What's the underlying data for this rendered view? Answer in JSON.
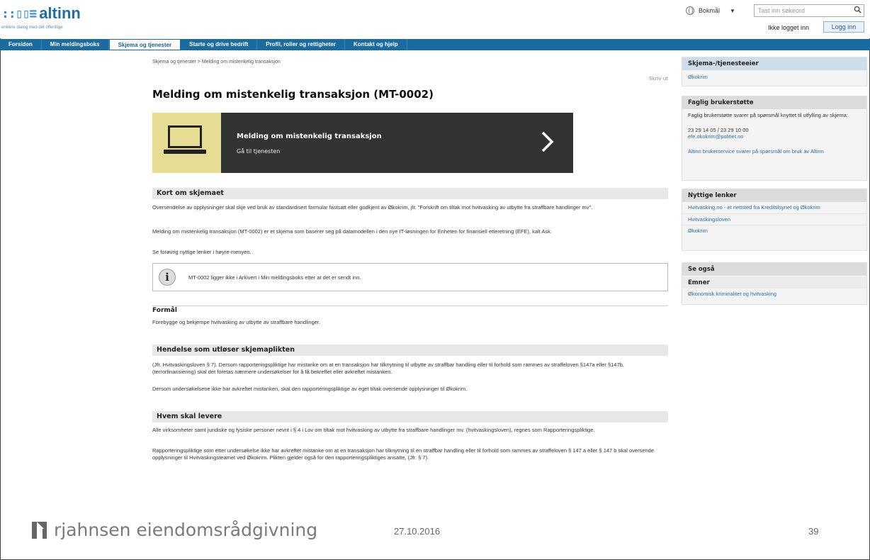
{
  "header": {
    "logo_mark": "::▯▯≡",
    "logo_text": "altinn",
    "tagline": "enklere dialog med det offentlige",
    "language": "Bokmål",
    "search_placeholder": "Tast inn søkeord",
    "login_status": "Ikke logget inn",
    "login_button": "Logg inn"
  },
  "nav": {
    "items": [
      {
        "label": "Forsiden"
      },
      {
        "label": "Min meldingsboks"
      },
      {
        "label": "Skjema og tjenester"
      },
      {
        "label": "Starte og drive bedrift"
      },
      {
        "label": "Profil, roller og rettigheter"
      },
      {
        "label": "Kontakt og hjelp"
      }
    ]
  },
  "main": {
    "breadcrumb": "Skjema og tjenester  >  Melding om mistenkelig transaksjon",
    "print": "Skriv ut",
    "title": "Melding om mistenkelig transaksjon (MT-0002)",
    "banner": {
      "title": "Melding om mistenkelig transaksjon",
      "subtitle": "Gå til tjenesten"
    },
    "section1": {
      "heading": "Kort om skjemaet",
      "p1": "Oversendelse av opplysninger skal skje ved bruk av standardisert formular fastsatt eller godkjent av Økokrim, jfr. \"Forskrift om tiltak mot hvitvasking av utbytte fra straffbare handlinger mv\".",
      "p2": "Melding om mistenkelig transaksjon (MT-0002) er et skjema som baserer seg på datamodellen i den nye IT-løsningen for Enheten for finansiell etteretning (EFE), kalt Ask.",
      "p3": "Se forøvrig nyttige lenker i høyre-menyen."
    },
    "info": "MT-0002 ligger ikke i Arkivert i Min meldingsboks etter at det er sendt inn.",
    "formal": {
      "heading": "Formål",
      "text": "Forebygge og bekjempe hvitvasking av utbytte av straffbare handlinger."
    },
    "section2": {
      "heading": "Hendelse som utløser skjemaplikten",
      "p1": "(Jfr. Hvitvaskingsloven § 7). Dersom rapporteringspliktige har mistanke om at en transaksjon har tilknytning til utbytte av straffbar handling eller til forhold som rammes av straffeloven §147a eller §147b, (terrorfinansiering) skal det foretas nærmere undersøkelser for å få bekreftet eller avkreftet mistanken.",
      "p2": "Dersom undersøkelsene ikke har avkreftet mistanken, skal den rapporteringspliktige av eget tiltak oversende opplysninger til Økokrim."
    },
    "section3": {
      "heading": "Hvem skal levere",
      "p1": "Alle virksomheter samt juridiske og fysiske personer nevnt i § 4 i Lov om tiltak mot hvitvasking av utbytte fra straffbare handlinger mv. (hvitvaskingsloven), regnes som Rapporteringspliktige.",
      "p2": "Rapporteringspliktige som etter undersøkelse ikke har avkreftet mistanke om at en transaksjon har tilknytning til en straffbar handling eller til forhold som rammes av straffeloven § 147 a eller § 147 b skal oversende opplysninger til Hvitvaskingsteamet ved Økokrim. Plikten gjelder også for den rapporteringspliktiges ansatte, (Jfr. § 7)."
    }
  },
  "sidebar": {
    "owner_heading": "Skjema-/tjenesteeier",
    "owner_link": "Økokrim",
    "support_heading": "Faglig brukerstøtte",
    "support_text": "Faglig brukerstøtte svarer på spørsmål knyttet til utfylling av skjema:",
    "support_phone": "23 29 14 05 / 23 29 10 00",
    "support_email": "efe.okokrim@politiet.no",
    "support_altinn": "Altinn brukerservice svarer på spørsmål om bruk av Altinn",
    "links_heading": "Nyttige lenker",
    "links": [
      {
        "label": "Hvitvasking.no - et nettsted fra Kredittilsynet og Økokrim"
      },
      {
        "label": "Hvitvaskingsloven"
      },
      {
        "label": "Økokrim"
      }
    ],
    "see_also_heading": "Se også",
    "topics_heading": "Emner",
    "topics_link": "Økonomisk kriminalitet og hvitvasking"
  },
  "footer": {
    "brand": "rjahnsen eiendomsrådgivning",
    "date": "27.10.2016",
    "page": "39"
  },
  "colors": {
    "nav_bg": "#1b6aa0",
    "banner_accent": "#e6dc94",
    "banner_dark": "#333333",
    "link": "#2a6ea6"
  }
}
